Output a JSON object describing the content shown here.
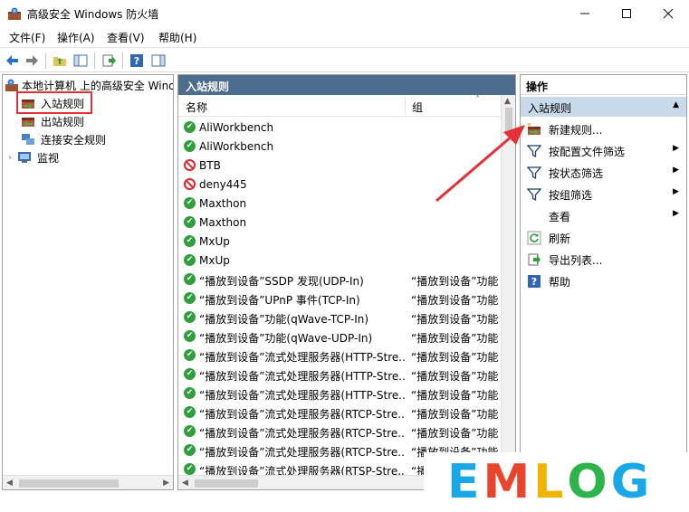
{
  "window": {
    "title": "高级安全 Windows 防火墙"
  },
  "menu": [
    "文件(F)",
    "操作(A)",
    "查看(V)",
    "帮助(H)"
  ],
  "tree": {
    "root": "本地计算机 上的高级安全 Wind",
    "items": [
      "入站规则",
      "出站规则",
      "连接安全规则",
      "监视"
    ]
  },
  "list": {
    "header": "入站规则",
    "columns": [
      "名称",
      "组"
    ],
    "rows": [
      {
        "name": "AliWorkbench",
        "group": "",
        "status": "allow"
      },
      {
        "name": "AliWorkbench",
        "group": "",
        "status": "allow"
      },
      {
        "name": "BTB",
        "group": "",
        "status": "block"
      },
      {
        "name": "deny445",
        "group": "",
        "status": "block"
      },
      {
        "name": "Maxthon",
        "group": "",
        "status": "allow"
      },
      {
        "name": "Maxthon",
        "group": "",
        "status": "allow"
      },
      {
        "name": "MxUp",
        "group": "",
        "status": "allow"
      },
      {
        "name": "MxUp",
        "group": "",
        "status": "allow"
      },
      {
        "name": "“播放到设备”SSDP 发现(UDP-In)",
        "group": "“播放到设备”功能",
        "status": "allow"
      },
      {
        "name": "“播放到设备”UPnP 事件(TCP-In)",
        "group": "“播放到设备”功能",
        "status": "allow"
      },
      {
        "name": "“播放到设备”功能(qWave-TCP-In)",
        "group": "“播放到设备”功能",
        "status": "allow"
      },
      {
        "name": "“播放到设备”功能(qWave-UDP-In)",
        "group": "“播放到设备”功能",
        "status": "allow"
      },
      {
        "name": "“播放到设备”流式处理服务器(HTTP-Stre...",
        "group": "“播放到设备”功能",
        "status": "allow"
      },
      {
        "name": "“播放到设备”流式处理服务器(HTTP-Stre...",
        "group": "“播放到设备”功能",
        "status": "allow"
      },
      {
        "name": "“播放到设备”流式处理服务器(HTTP-Stre...",
        "group": "“播放到设备”功能",
        "status": "allow"
      },
      {
        "name": "“播放到设备”流式处理服务器(RTCP-Stre...",
        "group": "“播放到设备”功能",
        "status": "allow"
      },
      {
        "name": "“播放到设备”流式处理服务器(RTCP-Stre...",
        "group": "“播放到设备”功能",
        "status": "allow"
      },
      {
        "name": "“播放到设备”流式处理服务器(RTCP-Stre...",
        "group": "“播放到设备”功能",
        "status": "allow"
      },
      {
        "name": "“播放到设备”流式处理服务器(RTSP-Stre...",
        "group": "“播放到设备”功能",
        "status": "allow"
      }
    ]
  },
  "actions": {
    "header": "操作",
    "group": "入站规则",
    "items": [
      {
        "label": "新建规则...",
        "icon": "new-rule-icon",
        "submenu": false
      },
      {
        "label": "按配置文件筛选",
        "icon": "filter-icon",
        "submenu": true
      },
      {
        "label": "按状态筛选",
        "icon": "filter-icon",
        "submenu": true
      },
      {
        "label": "按组筛选",
        "icon": "filter-icon",
        "submenu": true
      },
      {
        "label": "查看",
        "icon": "",
        "submenu": true
      },
      {
        "label": "刷新",
        "icon": "refresh-icon",
        "submenu": false
      },
      {
        "label": "导出列表...",
        "icon": "export-icon",
        "submenu": false
      },
      {
        "label": "帮助",
        "icon": "help-icon",
        "submenu": false
      }
    ]
  },
  "watermark": {
    "letters": [
      "E",
      "M",
      "L",
      "O",
      "G"
    ],
    "colors": [
      "#1aa7e8",
      "#e8452c",
      "#f0b400",
      "#2cb34a",
      "#1aa7e8"
    ]
  },
  "colors": {
    "accent": "#4d6d8f",
    "highlight": "#e23238",
    "allow": "#2f9e3c",
    "block": "#d8272b"
  }
}
